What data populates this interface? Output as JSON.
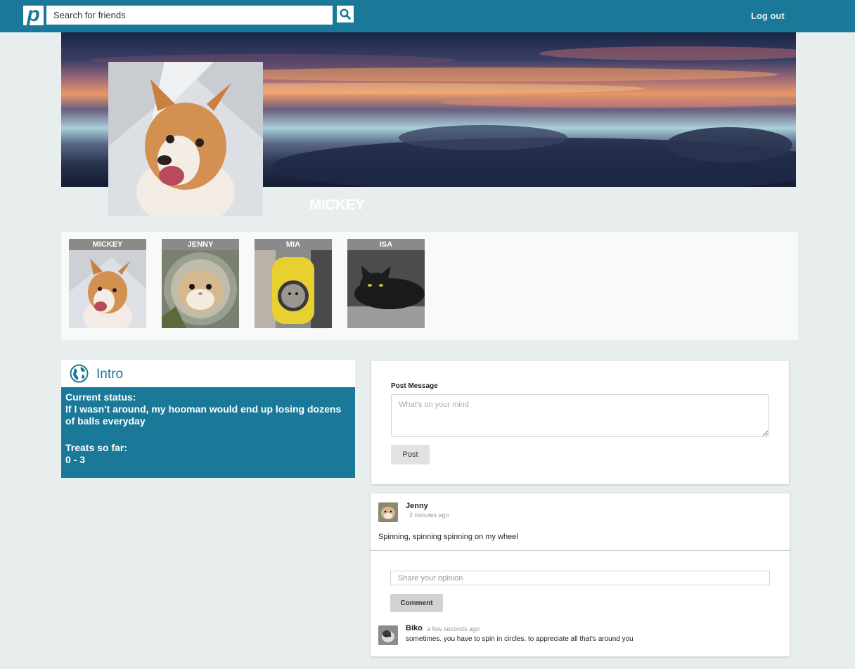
{
  "header": {
    "logo_letter": "p",
    "search_placeholder": "Search for friends",
    "logout_label": "Log out"
  },
  "profile": {
    "name": "MICKEY"
  },
  "friends": [
    {
      "name": "MICKEY"
    },
    {
      "name": "JENNY"
    },
    {
      "name": "MIA"
    },
    {
      "name": "ISA"
    }
  ],
  "intro": {
    "title": "Intro",
    "status_label": "Current status:",
    "status_text": "If I wasn't around, my hooman would end up losing dozens of balls everyday",
    "treats_label": "Treats so far:",
    "treats_value": "0 - 3"
  },
  "composer": {
    "label": "Post Message",
    "placeholder": "What's on your mind",
    "button_label": "Post"
  },
  "feed": {
    "post": {
      "author": "Jenny",
      "time": "2 minutes ago",
      "text": "Spinning, spinning spinning on my wheel"
    },
    "comment_placeholder": "Share your opinion",
    "comment_button_label": "Comment",
    "comments": [
      {
        "author": "Biko",
        "time": "a few seconds ago",
        "text": "sometimes. you have to spin in circles. to appreciate all that's around you"
      }
    ]
  },
  "colors": {
    "brand": "#1a7898",
    "background": "#e8eeee"
  }
}
